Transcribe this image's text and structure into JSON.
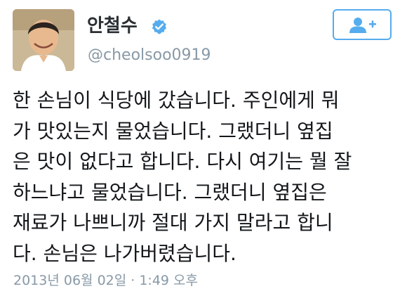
{
  "user": {
    "display_name": "안철수",
    "handle": "@cheolsoo0919",
    "verified": true
  },
  "icons": {
    "verified": "verified-badge-icon",
    "follow": "add-user-icon"
  },
  "tweet": {
    "text": "한 손님이 식당에 갔습니다. 주인에게 뭐\n가 맛있는지 물었습니다. 그랬더니 옆집\n은 맛이 없다고 합니다. 다시 여기는 뭘 잘\n하느냐고 물었습니다. 그랬더니 옆집은\n재료가 나쁘니까 절대 가지 말라고 합니\n다. 손님은 나가버렸습니다.",
    "timestamp": "2013년 06월 02일 · 1:49 오후"
  },
  "colors": {
    "accent": "#55acee",
    "secondary_text": "#8899a6",
    "primary_text": "#14171a"
  }
}
